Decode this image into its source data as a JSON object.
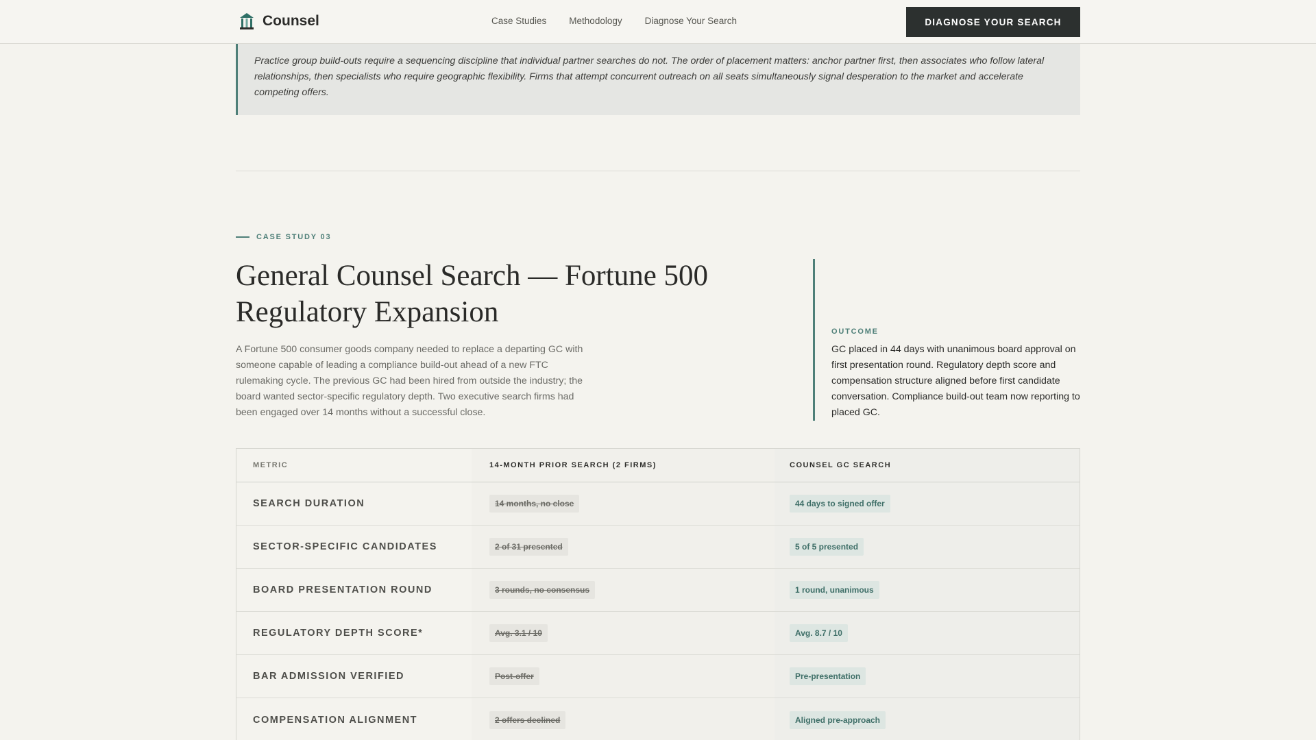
{
  "header": {
    "brand": "Counsel",
    "nav": [
      "Case Studies",
      "Methodology",
      "Diagnose Your Search"
    ],
    "cta_label": "DIAGNOSE YOUR SEARCH"
  },
  "quote": {
    "text": "Practice group build-outs require a sequencing discipline that individual partner searches do not. The order of placement matters: anchor partner first, then associates who follow lateral relationships, then specialists who require geographic flexibility. Firms that attempt concurrent outreach on all seats simultaneously signal desperation to the market and accelerate competing offers."
  },
  "case_study": {
    "kicker": "CASE STUDY 03",
    "title": "General Counsel Search — Fortune 500 Regulatory Expansion",
    "description": "A Fortune 500 consumer goods company needed to replace a departing GC with someone capable of leading a compliance build-out ahead of a new FTC rulemaking cycle. The previous GC had been hired from outside the industry; the board wanted sector-specific regulatory depth. Two executive search firms had been engaged over 14 months without a successful close.",
    "outcome_label": "OUTCOME",
    "outcome_text": "GC placed in 44 days with unanimous board approval on first presentation round. Regulatory depth score and compensation structure aligned before first candidate conversation. Compliance build-out team now reporting to placed GC."
  },
  "table": {
    "headers": [
      "METRIC",
      "14-MONTH PRIOR SEARCH (2 FIRMS)",
      "COUNSEL GC SEARCH"
    ],
    "rows": [
      {
        "metric": "SEARCH DURATION",
        "prior": "14 months, no close",
        "counsel": "44 days to signed offer"
      },
      {
        "metric": "SECTOR-SPECIFIC CANDIDATES",
        "prior": "2 of 31 presented",
        "counsel": "5 of 5 presented"
      },
      {
        "metric": "BOARD PRESENTATION ROUND",
        "prior": "3 rounds, no consensus",
        "counsel": "1 round, unanimous"
      },
      {
        "metric": "REGULATORY DEPTH SCORE*",
        "prior": "Avg. 3.1 / 10",
        "counsel": "Avg. 8.7 / 10"
      },
      {
        "metric": "BAR ADMISSION VERIFIED",
        "prior": "Post-offer",
        "counsel": "Pre-presentation"
      },
      {
        "metric": "COMPENSATION ALIGNMENT",
        "prior": "2 offers declined",
        "counsel": "Aligned pre-approach"
      }
    ]
  },
  "colors": {
    "accent": "#4e7f78",
    "dark": "#2c302f",
    "background": "#f4f3ee"
  }
}
